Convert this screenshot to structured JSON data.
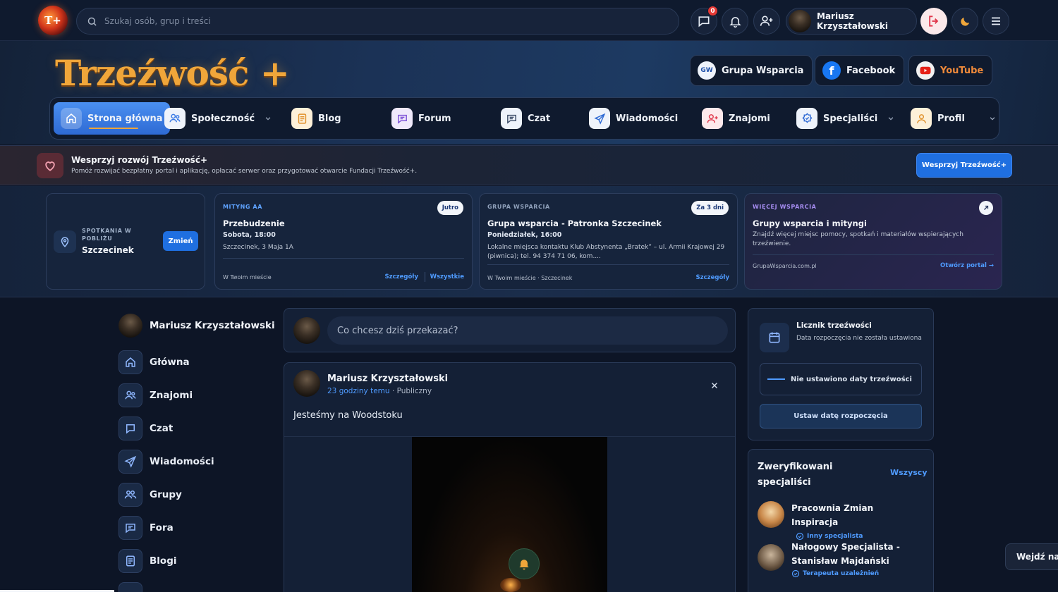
{
  "topbar": {
    "logo_text": "T+",
    "search_placeholder": "Szukaj osób, grup i treści",
    "messages_badge": "0",
    "user_name": "Mariusz Krzyształowski"
  },
  "hero": {
    "brand": "Trzeźwość +",
    "social": [
      {
        "icon": "gw",
        "label": "Grupa Wsparcia",
        "icon_text": "GW"
      },
      {
        "icon": "facebook",
        "label": "Facebook",
        "icon_text": "f"
      },
      {
        "icon": "youtube",
        "label": "YouTube"
      }
    ]
  },
  "nav": {
    "items": [
      {
        "label": "Strona główna",
        "icon": "home-icon",
        "active": true
      },
      {
        "label": "Społeczność",
        "icon": "users-icon",
        "dropdown": true
      },
      {
        "label": "Blog",
        "icon": "blog-icon"
      },
      {
        "label": "Forum",
        "icon": "forum-icon"
      },
      {
        "label": "Czat",
        "icon": "chat-icon"
      },
      {
        "label": "Wiadomości",
        "icon": "send-icon"
      },
      {
        "label": "Znajomi",
        "icon": "add-friend-icon"
      },
      {
        "label": "Specjaliści",
        "icon": "badge-icon",
        "dropdown": true
      },
      {
        "label": "Profil",
        "icon": "profile-icon",
        "dropdown": true
      }
    ]
  },
  "support": {
    "title": "Wesprzyj rozwój Trzeźwość+",
    "subtitle": "Pomóż rozwijać bezpłatny portal i aplikację, opłacać serwer oraz przygotować otwarcie Fundacji Trzeźwość+.",
    "button": "Wesprzyj Trzeźwość+"
  },
  "strip": {
    "location": {
      "tag": "SPOTKANIA W POBLIŻU",
      "city": "Szczecinek",
      "button": "Zmień"
    },
    "cards": [
      {
        "tag": "MITYNG AA",
        "pill": "Jutro",
        "title": "Przebudzenie",
        "when": "Sobota, 18:00",
        "address": "Szczecinek, 3 Maja 1A",
        "footer": "W Twoim mieście",
        "link1": "Szczegóły",
        "link2": "Wszystkie"
      },
      {
        "tag": "GRUPA WSPARCIA",
        "pill": "Za 3 dni",
        "title": "Grupa wsparcia - Patronka Szczecinek",
        "when": "Poniedziałek, 16:00",
        "address": "Lokalne miejsca kontaktu Klub Abstynenta „Bratek” – ul. Armii Krajowej 29 (piwnica); tel. 94 374 71 06, kom....",
        "footer": "W Twoim mieście · Szczecinek",
        "link1": "Szczegóły"
      },
      {
        "tag": "WIĘCEJ WSPARCIA",
        "title": "Grupy wsparcia i mityngi",
        "desc": "Znajdź więcej miejsc pomocy, spotkań i materiałów wspierających trzeźwienie.",
        "footer": "GrupaWsparcia.com.pl",
        "link1": "Otwórz portal →"
      }
    ]
  },
  "sidebar": {
    "user_name": "Mariusz Krzyształowski",
    "items": [
      {
        "label": "Główna",
        "icon": "home-icon"
      },
      {
        "label": "Znajomi",
        "icon": "users-icon"
      },
      {
        "label": "Czat",
        "icon": "chat-icon"
      },
      {
        "label": "Wiadomości",
        "icon": "send-icon"
      },
      {
        "label": "Grupy",
        "icon": "group-icon"
      },
      {
        "label": "Fora",
        "icon": "forum-icon"
      },
      {
        "label": "Blogi",
        "icon": "blog-icon"
      }
    ]
  },
  "feed": {
    "composer_placeholder": "Co chcesz dziś przekazać?",
    "post": {
      "author": "Mariusz Krzyształowski",
      "time": "23 godziny temu",
      "visibility": "· Publiczny",
      "text": "Jesteśmy na Woodstoku"
    }
  },
  "counter": {
    "title": "Licznik trzeźwości",
    "subtitle": "Data rozpoczęcia nie została ustawiona",
    "status": "Nie ustawiono daty trzeźwości",
    "button": "Ustaw datę rozpoczęcia"
  },
  "specialists": {
    "title": "Zweryfikowani specjaliści",
    "all": "Wszyscy",
    "items": [
      {
        "name": "Pracownia Zmian Inspiracja",
        "role": "Inny specjalista"
      },
      {
        "name": "Nałogowy Specjalista - Stanisław Majdański",
        "role": "Terapeuta uzależnień"
      }
    ]
  },
  "enter_button": "Wejdź na"
}
